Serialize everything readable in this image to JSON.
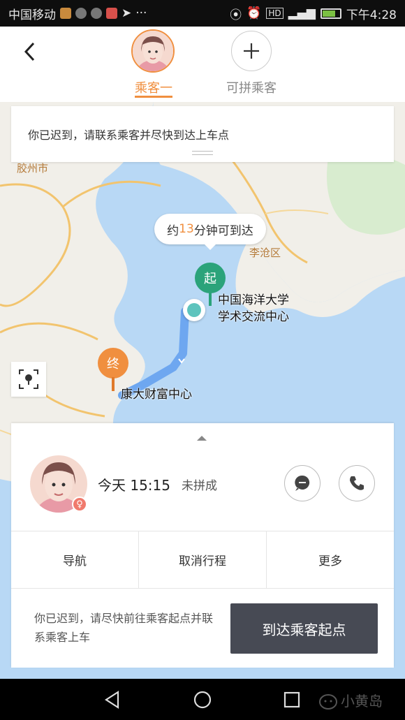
{
  "status_bar": {
    "carrier": "中国移动",
    "time": "下午4:28"
  },
  "header": {
    "passenger_tab": "乘客一",
    "add_label": "可拼乘客"
  },
  "map": {
    "notice": "你已迟到，请联系乘客并尽快到达上车点",
    "eta_prefix": "约",
    "eta_minutes": "13",
    "eta_suffix": "分钟可到达",
    "start_marker": "起",
    "end_marker": "终",
    "start_place_line1": "中国海洋大学",
    "start_place_line2": "学术交流中心",
    "end_place": "康大财富中心",
    "district_label": "李沧区",
    "city_label": "胶州市"
  },
  "trip": {
    "time": "今天 15:15",
    "status": "未拼成",
    "actions": [
      "导航",
      "取消行程",
      "更多"
    ],
    "hint": "你已迟到，请尽快前往乘客起点并联系乘客上车",
    "arrive_button": "到达乘客起点"
  },
  "nav": {
    "watermark": "小黄岛"
  },
  "colors": {
    "accent": "#f08f3f",
    "start_green": "#2ba37a",
    "route_blue": "#6ea7f0",
    "button_dark": "#474a54"
  }
}
